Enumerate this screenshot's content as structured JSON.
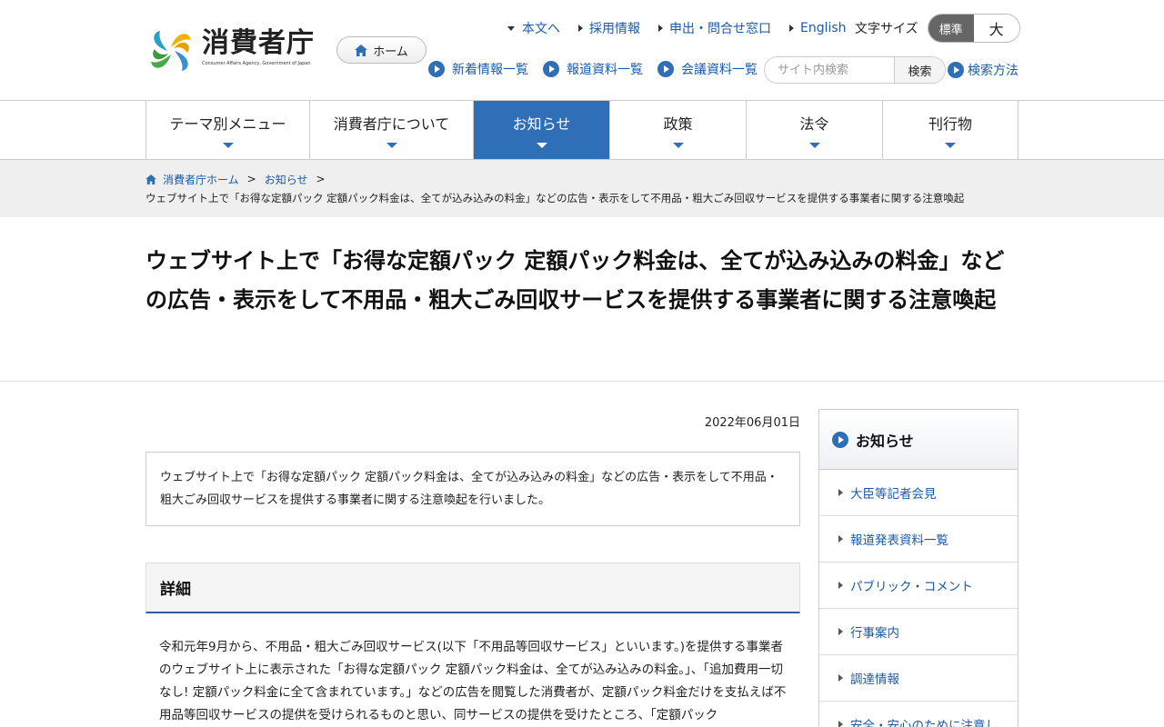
{
  "header": {
    "logo_text": "消費者庁",
    "logo_en": "Consumer Affairs Agency, Government of Japan",
    "home_label": "ホーム",
    "util_links": [
      {
        "label": "本文へ",
        "marker": "down"
      },
      {
        "label": "採用情報",
        "marker": "right"
      },
      {
        "label": "申出・問合せ窓口",
        "marker": "right"
      },
      {
        "label": "English",
        "marker": "right"
      }
    ],
    "font_size_label": "文字サイズ",
    "font_size_standard": "標準",
    "font_size_large": "大",
    "quick_links": [
      "新着情報一覧",
      "報道資料一覧",
      "会議資料一覧"
    ],
    "search_placeholder": "サイト内検索",
    "search_button": "検索",
    "search_help": "検索方法"
  },
  "gnav": {
    "items": [
      {
        "label": "テーマ別メニュー",
        "active": false
      },
      {
        "label": "消費者庁について",
        "active": false
      },
      {
        "label": "お知らせ",
        "active": true
      },
      {
        "label": "政策",
        "active": false
      },
      {
        "label": "法令",
        "active": false
      },
      {
        "label": "刊行物",
        "active": false
      }
    ]
  },
  "breadcrumb": {
    "home": "消費者庁ホーム",
    "sep": ">",
    "news": "お知らせ",
    "current": "ウェブサイト上で「お得な定額パック 定額パック料金は、全てが込み込みの料金」などの広告・表示をして不用品・粗大ごみ回収サービスを提供する事業者に関する注意喚起"
  },
  "page": {
    "title": "ウェブサイト上で「お得な定額パック 定額パック料金は、全てが込み込みの料金」などの広告・表示をして不用品・粗大ごみ回収サービスを提供する事業者に関する注意喚起",
    "date": "2022年06月01日",
    "summary": "ウェブサイト上で「お得な定額パック 定額パック料金は、全てが込み込みの料金」などの広告・表示をして不用品・粗大ごみ回収サービスを提供する事業者に関する注意喚起を行いました。",
    "section_heading": "詳細",
    "body": "令和元年9月から、不用品・粗大ごみ回収サービス(以下「不用品等回収サービス」といいます。)を提供する事業者のウェブサイト上に表示された「お得な定額パック 定額パック料金は、全てが込み込みの料金。」、「追加費用一切なし! 定額パック料金に全て含まれています。」などの広告を閲覧した消費者が、定額パック料金だけを支払えば不用品等回収サービスの提供を受けられるものと思い、同サービスの提供を受けたところ、「定額パック"
  },
  "sidebar": {
    "heading": "お知らせ",
    "items": [
      "大臣等記者会見",
      "報道発表資料一覧",
      "パブリック・コメント",
      "行事案内",
      "調達情報",
      "安全・安心のために注意し"
    ]
  },
  "colors": {
    "accent": "#2e6fb8",
    "link": "#1a5aa8",
    "crumb_bg": "#efefef"
  }
}
